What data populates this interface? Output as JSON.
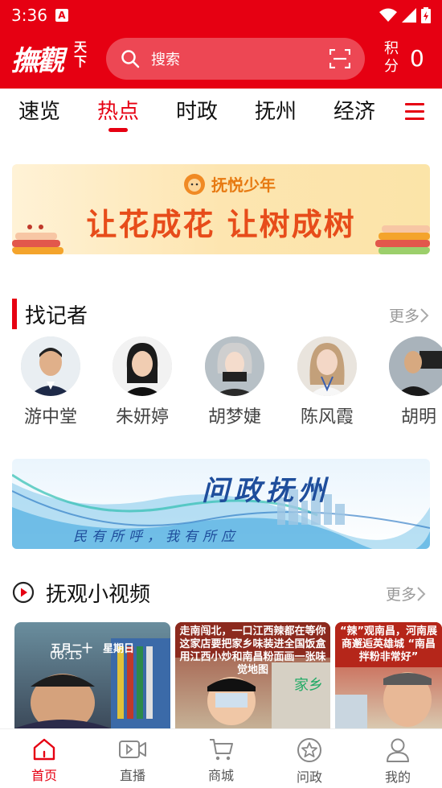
{
  "status": {
    "time": "3:36",
    "notification_icon": "A"
  },
  "header": {
    "logo_main": "撫觀",
    "logo_sub_1": "天",
    "logo_sub_2": "下",
    "search_placeholder": "搜索",
    "points_label_1": "积",
    "points_label_2": "分",
    "points_value": "0"
  },
  "tabs": [
    "速览",
    "热点",
    "时政",
    "抚州",
    "经济"
  ],
  "active_tab": "热点",
  "banner1": {
    "brand": "抚悦少年",
    "slogan": "让花成花  让树成树"
  },
  "reporters_section": {
    "title": "找记者",
    "more": "更多",
    "reporters": [
      "游中堂",
      "朱妍婷",
      "胡梦婕",
      "陈风霞",
      "胡明"
    ]
  },
  "banner2": {
    "title": "问政抚州",
    "subtitle": "民有所呼，我有所应"
  },
  "video_section": {
    "title": "抚观小视频",
    "more": "更多",
    "videos": [
      {
        "caption": "五月二十　星期日",
        "time_text": "06:15"
      },
      {
        "caption": "走南闯北，一口江西辣都在等你 这家店要把家乡味装进全国饭盒 用江西小炒和南昌粉面画一张味觉地图"
      },
      {
        "caption": "“辣”观南昌，河南展商邂逅英雄城 “南昌拌粉非常好”"
      }
    ]
  },
  "tabbar": [
    {
      "label": "首页",
      "icon": "home-icon"
    },
    {
      "label": "直播",
      "icon": "video-icon"
    },
    {
      "label": "商城",
      "icon": "cart-icon"
    },
    {
      "label": "问政",
      "icon": "star-icon"
    },
    {
      "label": "我的",
      "icon": "user-icon"
    }
  ],
  "colors": {
    "brand_red": "#e60012"
  }
}
